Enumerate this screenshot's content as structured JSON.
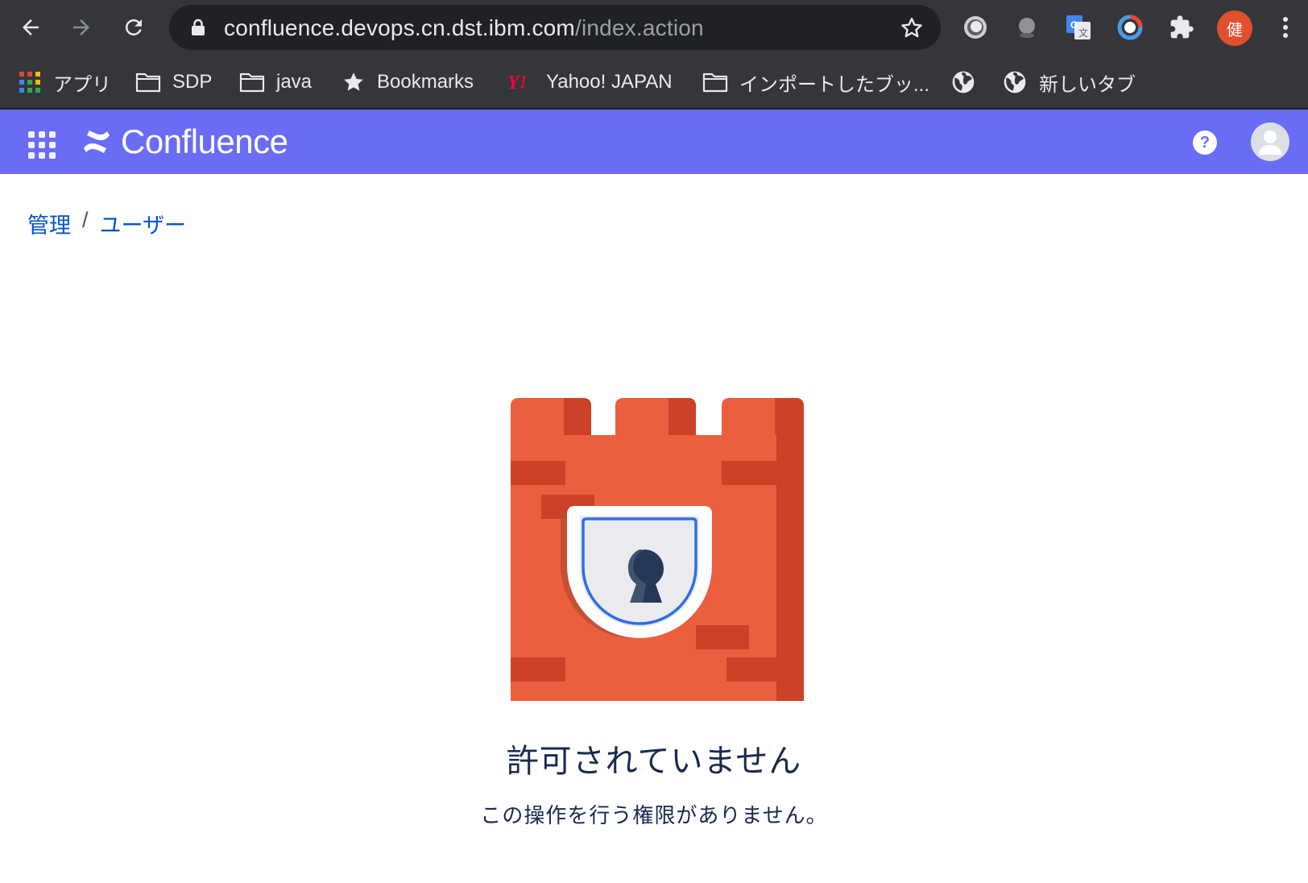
{
  "browser": {
    "url_host": "confluence.devops.cn.dst.ibm.com",
    "url_path": "/index.action",
    "profile_initial": "健",
    "bookmarks": [
      {
        "label": "アプリ",
        "icon": "apps-grid-icon"
      },
      {
        "label": "SDP",
        "icon": "folder-icon"
      },
      {
        "label": "java",
        "icon": "folder-icon"
      },
      {
        "label": "Bookmarks",
        "icon": "star-icon"
      },
      {
        "label": "Yahoo! JAPAN",
        "icon": "yahoo-icon"
      },
      {
        "label": "インポートしたブッ...",
        "icon": "folder-icon"
      },
      {
        "label": "",
        "icon": "globe-icon"
      },
      {
        "label": "新しいタブ",
        "icon": "globe-icon"
      }
    ]
  },
  "header": {
    "product_name": "Confluence",
    "brand_color": "#6a6cf6"
  },
  "breadcrumb": {
    "items": [
      "管理",
      "ユーザー"
    ],
    "separator": "/"
  },
  "error": {
    "title": "許可されていません",
    "message": "この操作を行う権限がありません。"
  }
}
